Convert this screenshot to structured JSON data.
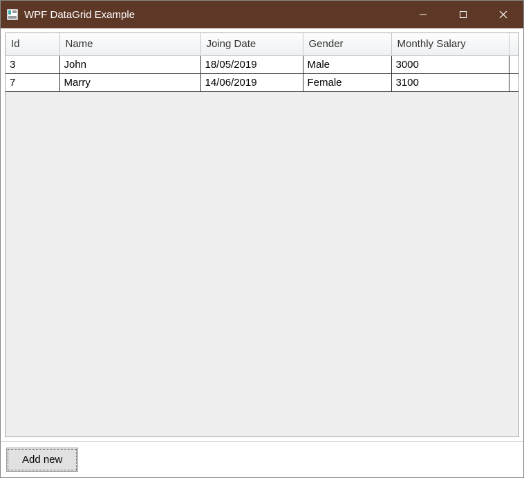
{
  "window": {
    "title": "WPF DataGrid Example"
  },
  "datagrid": {
    "columns": [
      "Id",
      "Name",
      "Joing Date",
      "Gender",
      "Monthly Salary"
    ],
    "rows": [
      {
        "id": "3",
        "name": "John",
        "joining_date": "18/05/2019",
        "gender": "Male",
        "salary": "3000"
      },
      {
        "id": "7",
        "name": "Marry",
        "joining_date": "14/06/2019",
        "gender": "Female",
        "salary": "3100"
      }
    ]
  },
  "buttons": {
    "add_new": "Add new"
  }
}
